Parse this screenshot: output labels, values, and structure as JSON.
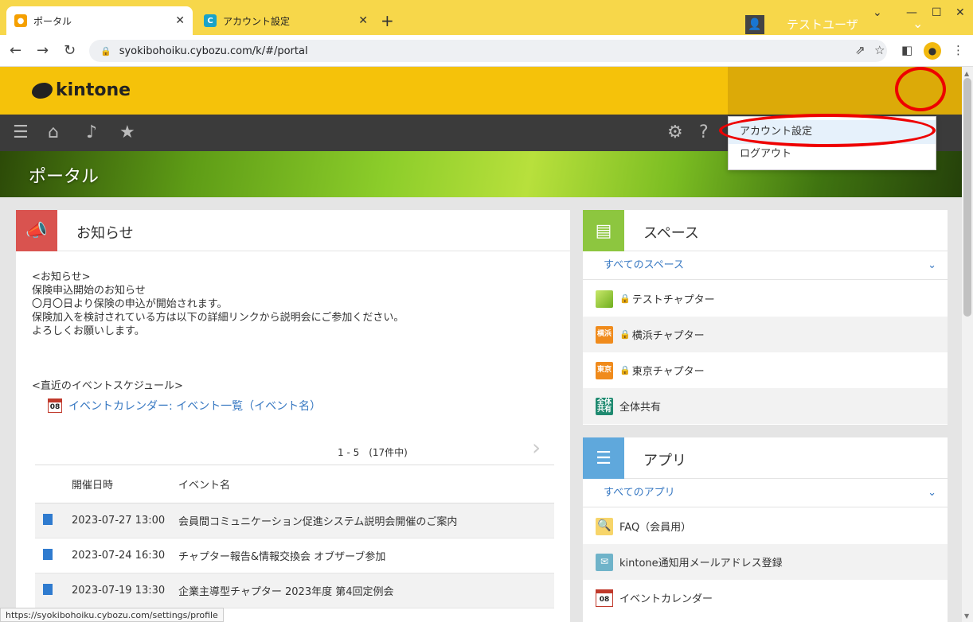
{
  "browser": {
    "tabs": [
      {
        "title": "ポータル",
        "active": true
      },
      {
        "title": "アカウント設定",
        "active": false
      }
    ],
    "url": "syokibohoiku.cybozu.com/k/#/portal",
    "status_url": "https://syokibohoiku.cybozu.com/settings/profile"
  },
  "header": {
    "logo": "kintone",
    "username": "テストユーザ"
  },
  "banner": {
    "title": "ポータル"
  },
  "user_menu": {
    "items": [
      {
        "label": "アカウント設定"
      },
      {
        "label": "ログアウト"
      }
    ]
  },
  "notice": {
    "title": "お知らせ",
    "lines": [
      "<お知らせ>",
      "保険申込開始のお知らせ",
      "〇月〇日より保険の申込が開始されます。",
      "保険加入を検討されている方は以下の詳細リンクから説明会にご参加ください。",
      "よろしくお願いします。"
    ],
    "schedule_heading": "<直近のイベントスケジュール>",
    "calendar_link": "イベントカレンダー: イベント一覧（イベント名）",
    "calendar_icon_text": "08",
    "pager": "1 - 5　(17件中)",
    "table": {
      "headers": [
        "開催日時",
        "イベント名"
      ],
      "rows": [
        {
          "date": "2023-07-27 13:00",
          "name": "会員間コミュニケーション促進システム説明会開催のご案内"
        },
        {
          "date": "2023-07-24 16:30",
          "name": "チャプター報告&情報交換会 オブザーブ参加"
        },
        {
          "date": "2023-07-19 13:30",
          "name": "企業主導型チャプター 2023年度 第4回定例会"
        }
      ]
    }
  },
  "spaces": {
    "title": "スペース",
    "filter": "すべてのスペース",
    "items": [
      {
        "label": "テストチャプター",
        "icon_text": "",
        "locked": true
      },
      {
        "label": "横浜チャプター",
        "icon_text": "横浜",
        "locked": true
      },
      {
        "label": "東京チャプター",
        "icon_text": "東京",
        "locked": true
      },
      {
        "label": "全体共有",
        "icon_text": "全体共有",
        "locked": false
      }
    ]
  },
  "apps": {
    "title": "アプリ",
    "filter": "すべてのアプリ",
    "items": [
      {
        "label": "FAQ（会員用）"
      },
      {
        "label": "kintone通知用メールアドレス登録"
      },
      {
        "label": "イベントカレンダー",
        "icon_text": "08"
      }
    ]
  },
  "colors": {
    "brand_yellow": "#f5c20a",
    "link_blue": "#3778c2",
    "highlight_red": "#e00000"
  }
}
